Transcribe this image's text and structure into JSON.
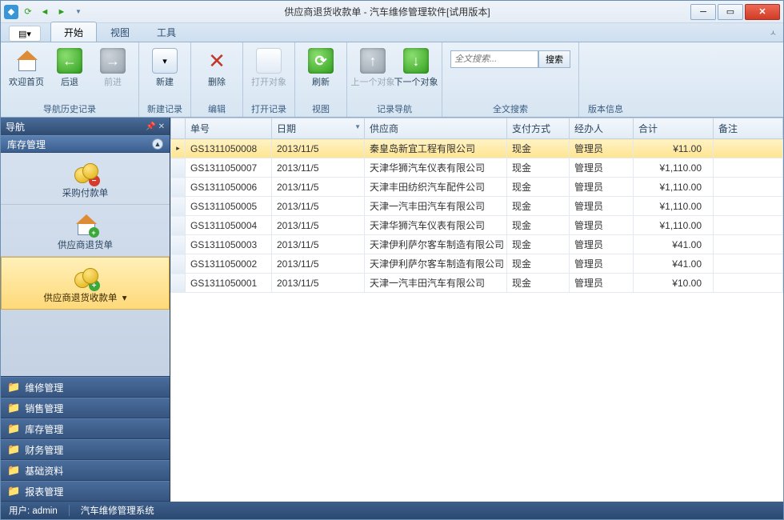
{
  "window": {
    "title": "供应商退货收款单 - 汽车维修管理软件[试用版本]"
  },
  "ribbon": {
    "tabs": [
      "开始",
      "视图",
      "工具"
    ],
    "active_tab": "开始",
    "groups": {
      "nav_history": {
        "label": "导航历史记录",
        "home": "欢迎首页",
        "back": "后退",
        "forward": "前进"
      },
      "new_record": {
        "label": "新建记录",
        "new": "新建"
      },
      "edit": {
        "label": "编辑",
        "delete": "删除"
      },
      "open_record": {
        "label": "打开记录",
        "open": "打开对象"
      },
      "view": {
        "label": "视图",
        "refresh": "刷新"
      },
      "record_nav": {
        "label": "记录导航",
        "prev": "上一个对象",
        "next": "下一个对象"
      },
      "fulltext": {
        "label": "全文搜索",
        "placeholder": "全文搜索...",
        "button": "搜索"
      },
      "about": {
        "label": "版本信息"
      }
    }
  },
  "nav": {
    "title": "导航",
    "section": "库存管理",
    "items": [
      {
        "label": "采购付款单",
        "selected": false,
        "badge": "red"
      },
      {
        "label": "供应商退货单",
        "selected": false,
        "badge": "green",
        "house": true
      },
      {
        "label": "供应商退货收款单",
        "selected": true,
        "badge": "green"
      }
    ],
    "groups": [
      "维修管理",
      "销售管理",
      "库存管理",
      "财务管理",
      "基础资料",
      "报表管理"
    ]
  },
  "grid": {
    "columns": [
      "单号",
      "日期",
      "供应商",
      "支付方式",
      "经办人",
      "合计",
      "备注"
    ],
    "sort_col": 1,
    "rows": [
      {
        "id": "GS1311050008",
        "date": "2013/11/5",
        "supplier": "秦皇岛新宜工程有限公司",
        "pay": "现金",
        "agent": "管理员",
        "total": "¥11.00",
        "note": "",
        "selected": true
      },
      {
        "id": "GS1311050007",
        "date": "2013/11/5",
        "supplier": "天津华狮汽车仪表有限公司",
        "pay": "现金",
        "agent": "管理员",
        "total": "¥1,110.00",
        "note": ""
      },
      {
        "id": "GS1311050006",
        "date": "2013/11/5",
        "supplier": "天津丰田纺织汽车配件公司",
        "pay": "现金",
        "agent": "管理员",
        "total": "¥1,110.00",
        "note": ""
      },
      {
        "id": "GS1311050005",
        "date": "2013/11/5",
        "supplier": "天津一汽丰田汽车有限公司",
        "pay": "现金",
        "agent": "管理员",
        "total": "¥1,110.00",
        "note": ""
      },
      {
        "id": "GS1311050004",
        "date": "2013/11/5",
        "supplier": "天津华狮汽车仪表有限公司",
        "pay": "现金",
        "agent": "管理员",
        "total": "¥1,110.00",
        "note": ""
      },
      {
        "id": "GS1311050003",
        "date": "2013/11/5",
        "supplier": "天津伊利萨尔客车制造有限公司",
        "pay": "现金",
        "agent": "管理员",
        "total": "¥41.00",
        "note": ""
      },
      {
        "id": "GS1311050002",
        "date": "2013/11/5",
        "supplier": "天津伊利萨尔客车制造有限公司",
        "pay": "现金",
        "agent": "管理员",
        "total": "¥41.00",
        "note": ""
      },
      {
        "id": "GS1311050001",
        "date": "2013/11/5",
        "supplier": "天津一汽丰田汽车有限公司",
        "pay": "现金",
        "agent": "管理员",
        "total": "¥10.00",
        "note": ""
      }
    ]
  },
  "status": {
    "user_label": "用户:",
    "user": "admin",
    "system": "汽车维修管理系统"
  }
}
